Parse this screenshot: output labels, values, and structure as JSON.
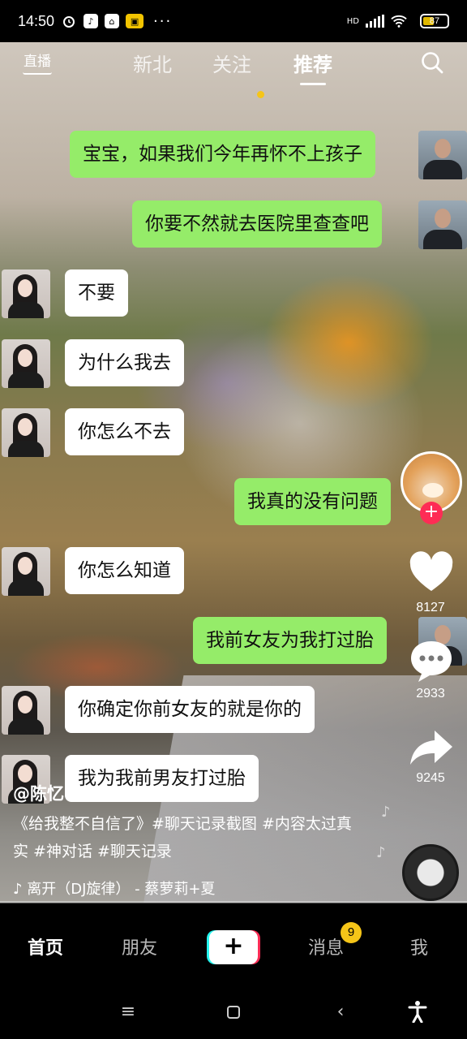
{
  "status_bar": {
    "time": "14:50",
    "battery": "87",
    "network": "HD"
  },
  "top_tabs": {
    "live": "直播",
    "tabs": [
      "新北",
      "关注",
      "推荐"
    ],
    "active": "推荐"
  },
  "chat": [
    {
      "side": "right",
      "text": "宝宝，如果我们今年再怀不上孩子"
    },
    {
      "side": "right",
      "text": "你要不然就去医院里查查吧"
    },
    {
      "side": "left",
      "text": "不要"
    },
    {
      "side": "left",
      "text": "为什么我去"
    },
    {
      "side": "left",
      "text": "你怎么不去"
    },
    {
      "side": "right",
      "text": "我真的没有问题"
    },
    {
      "side": "left",
      "text": "你怎么知道"
    },
    {
      "side": "right",
      "text": "我前女友为我打过胎"
    },
    {
      "side": "left",
      "text": "你确定你前女友的就是你的"
    },
    {
      "side": "left",
      "text": "我为我前男友打过胎"
    }
  ],
  "rail": {
    "follow": "+",
    "likes": "8127",
    "comments": "2933",
    "shares": "9245"
  },
  "post": {
    "author": "@陈忆",
    "caption": "《给我整不自信了》#聊天记录截图 #内容太过真实 #神对话 #聊天记录",
    "music": "离开（DJ旋律） - 蔡萝莉+夏"
  },
  "bottom_nav": {
    "items": [
      "首页",
      "朋友",
      "消息",
      "我"
    ],
    "create": "+",
    "messages_badge": "9"
  },
  "colors": {
    "wechat_green": "#95ec69",
    "accent_red": "#fe2c55",
    "accent_cyan": "#25f4ee",
    "badge_yellow": "#f5c518"
  }
}
